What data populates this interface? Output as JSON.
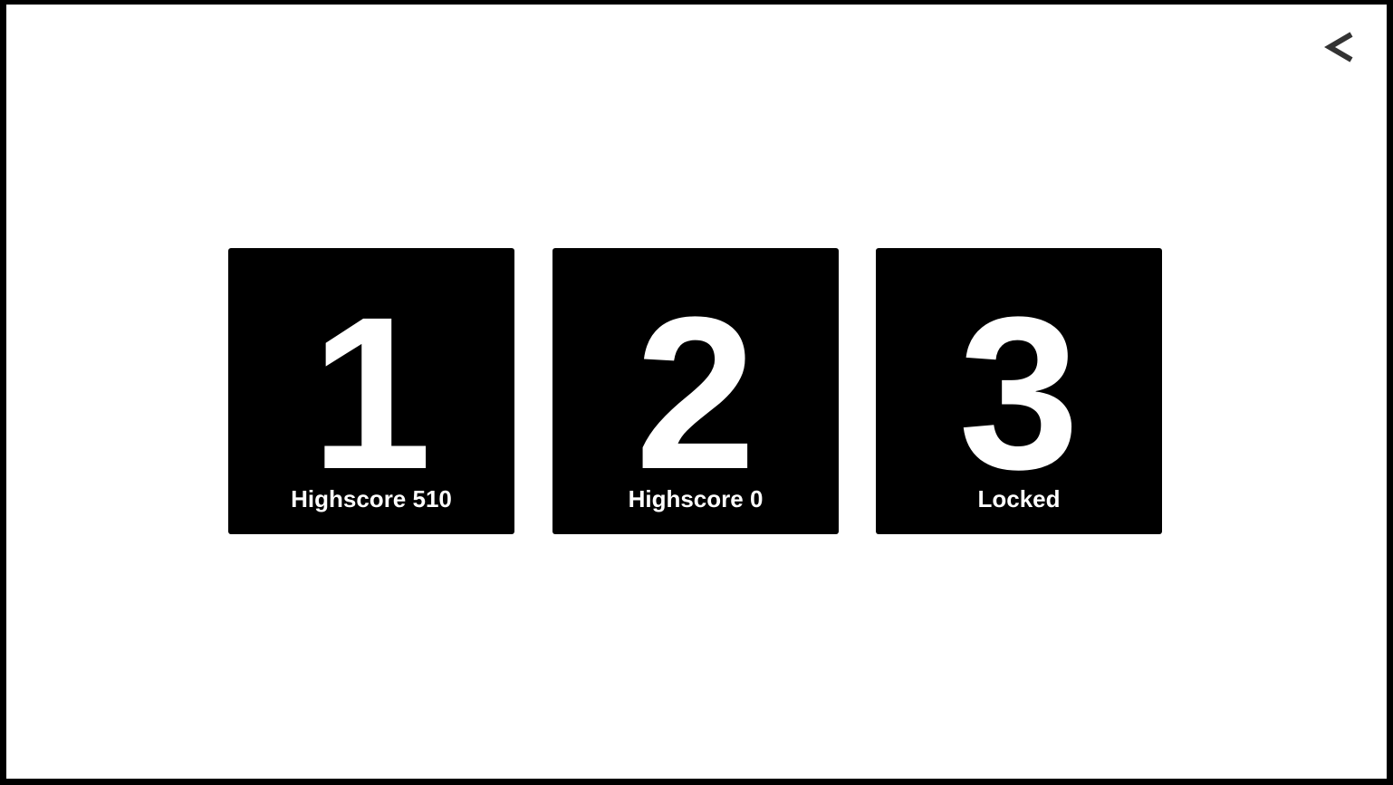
{
  "header": {
    "back_icon": "chevron-left-icon"
  },
  "colors": {
    "background": "#ffffff",
    "tile": "#000000",
    "tile_text": "#ffffff",
    "back_icon": "#333333"
  },
  "levels": [
    {
      "number": "1",
      "status": "Highscore 510",
      "locked": false
    },
    {
      "number": "2",
      "status": "Highscore 0",
      "locked": false
    },
    {
      "number": "3",
      "status": "Locked",
      "locked": true
    }
  ]
}
